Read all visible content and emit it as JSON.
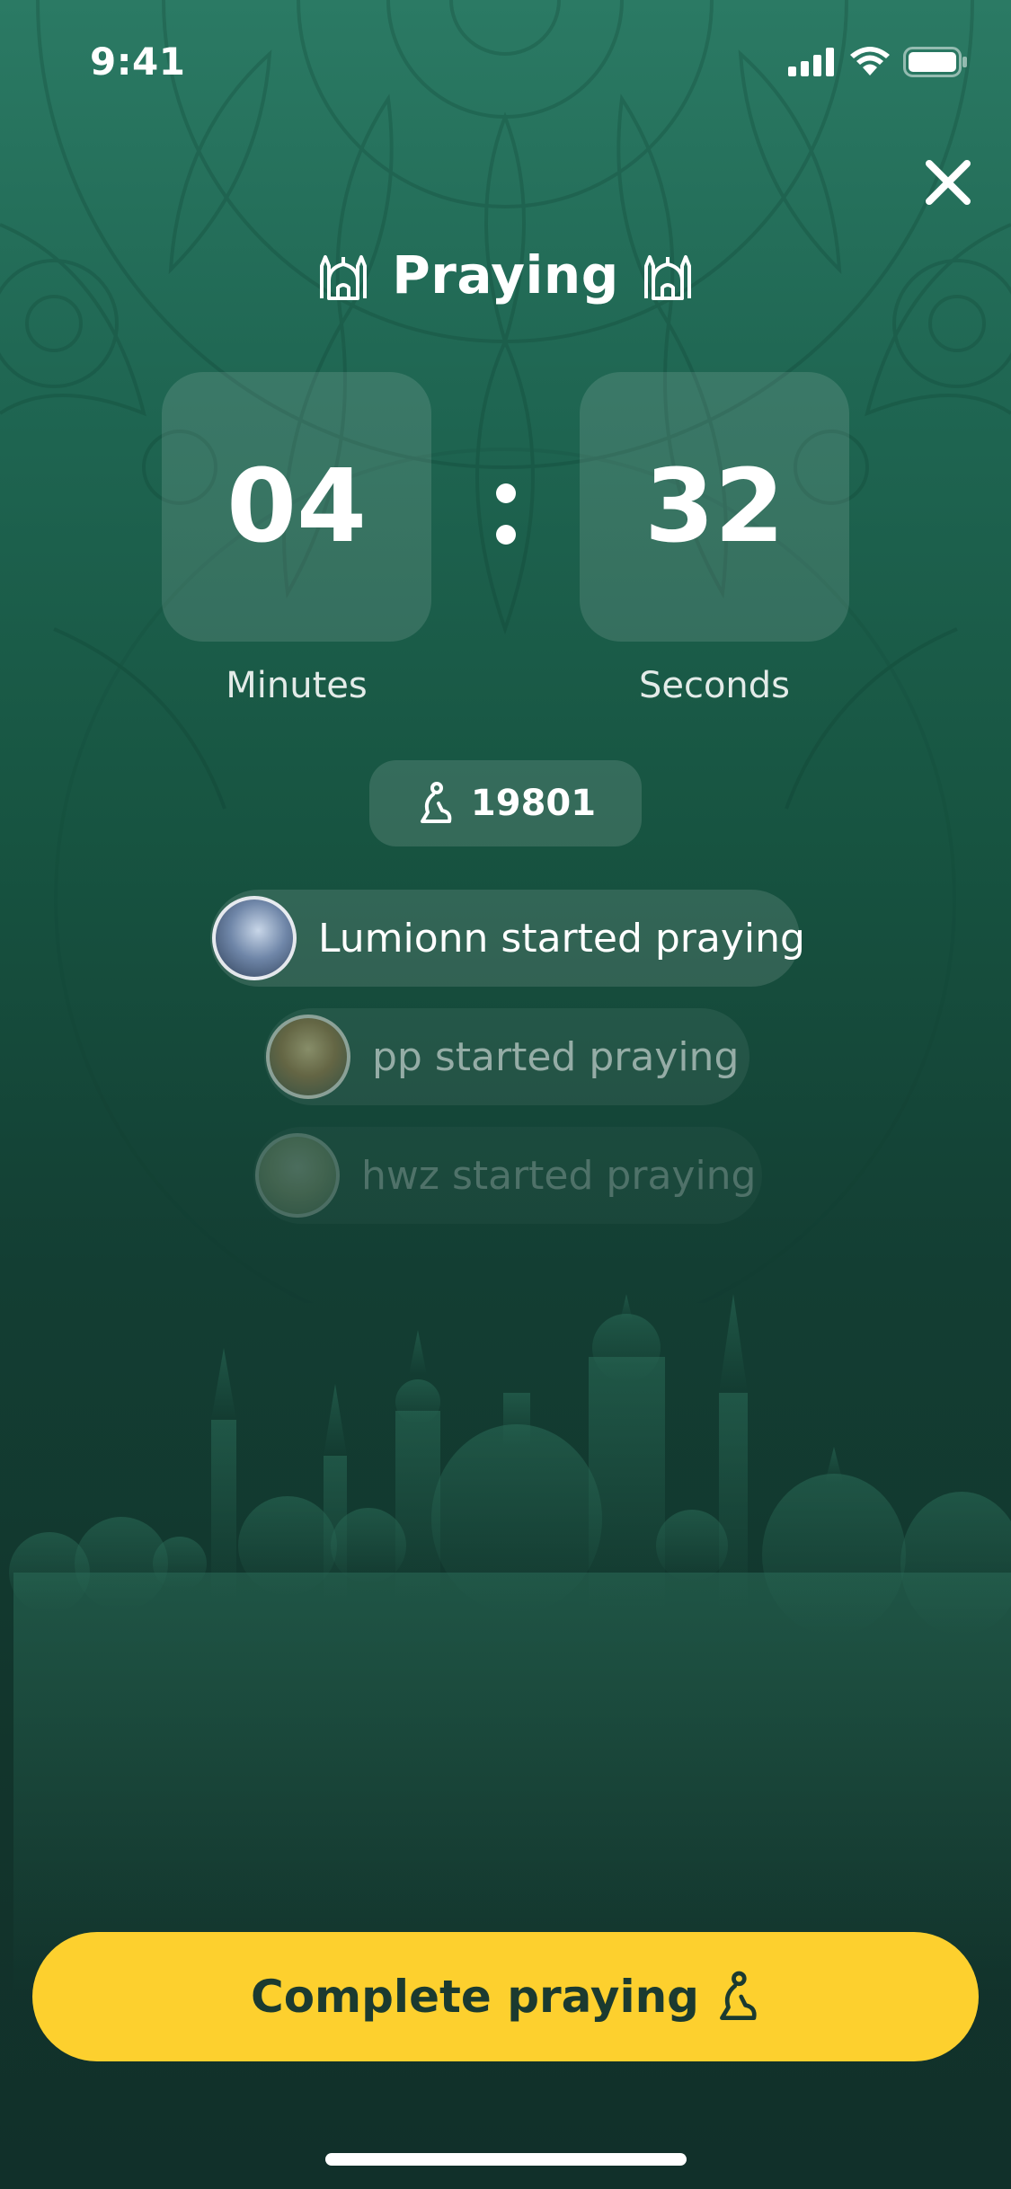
{
  "status_bar": {
    "time": "9:41"
  },
  "header": {
    "title": "Praying"
  },
  "timer": {
    "minutes": "04",
    "seconds": "32",
    "minutes_label": "Minutes",
    "seconds_label": "Seconds",
    "separator": ":"
  },
  "counter": {
    "value": "19801"
  },
  "feed": [
    {
      "text": "Lumionn started praying"
    },
    {
      "text": "pp started praying"
    },
    {
      "text": "hwz started praying"
    }
  ],
  "actions": {
    "complete_label": "Complete praying"
  },
  "colors": {
    "accent": "#fdd02e",
    "background_top": "#2b7a64",
    "background_bottom": "#11302a",
    "button_text": "#1b3a30"
  },
  "icons": [
    "mosque-icon",
    "prayer-person-icon",
    "close-icon",
    "signal-icon",
    "wifi-icon",
    "battery-icon"
  ]
}
